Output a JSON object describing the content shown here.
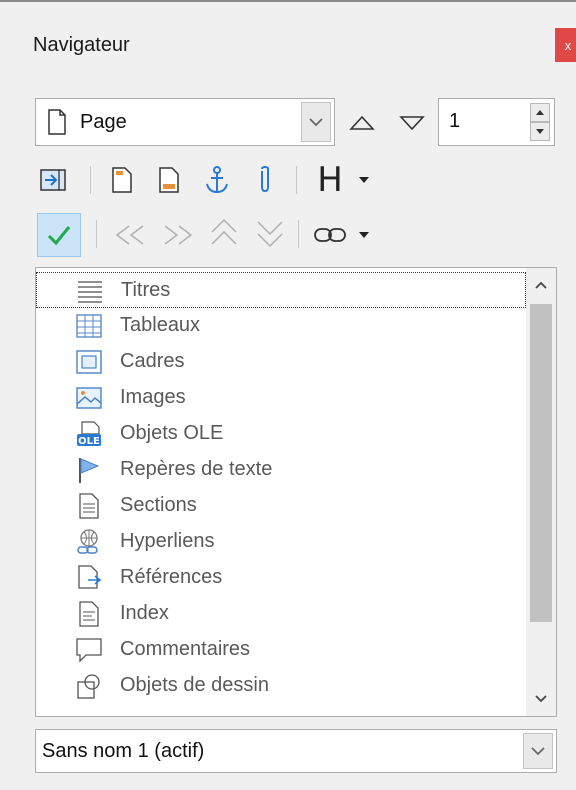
{
  "window": {
    "title": "Navigateur",
    "close_label": "x"
  },
  "navigate_by": {
    "selected": "Page",
    "page_number": "1"
  },
  "toolbar1": {
    "heading_label": "H"
  },
  "content_items": [
    {
      "label": "Titres",
      "icon": "headings-icon"
    },
    {
      "label": "Tableaux",
      "icon": "table-icon"
    },
    {
      "label": "Cadres",
      "icon": "frame-icon"
    },
    {
      "label": "Images",
      "icon": "image-icon"
    },
    {
      "label": "Objets OLE",
      "icon": "ole-icon"
    },
    {
      "label": "Repères de texte",
      "icon": "bookmark-flag-icon"
    },
    {
      "label": "Sections",
      "icon": "section-icon"
    },
    {
      "label": "Hyperliens",
      "icon": "hyperlink-globe-icon"
    },
    {
      "label": "Références",
      "icon": "reference-icon"
    },
    {
      "label": "Index",
      "icon": "index-icon"
    },
    {
      "label": "Commentaires",
      "icon": "comment-icon"
    },
    {
      "label": "Objets de dessin",
      "icon": "drawing-object-icon"
    }
  ],
  "document_select": {
    "selected": "Sans nom 1 (actif)"
  },
  "colors": {
    "accent": "#1e72c8",
    "anchor_blue": "#2a7ad5",
    "close_red": "#e04848",
    "check_green": "#22a84a",
    "check_bg": "#cce4f7"
  }
}
